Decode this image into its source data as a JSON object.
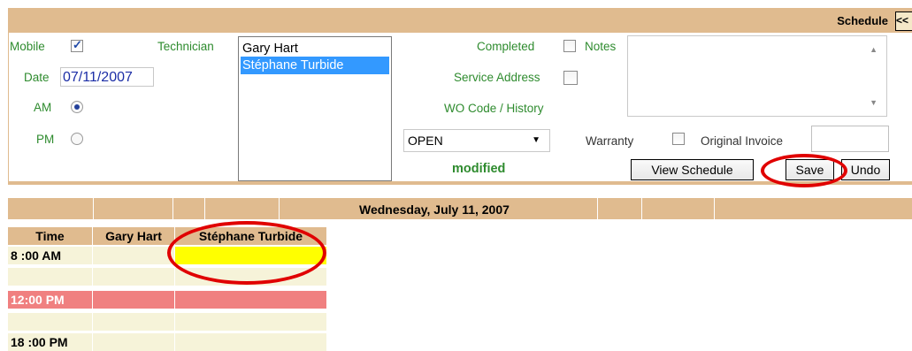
{
  "header": {
    "title": "Schedule",
    "collapse_label": "<<"
  },
  "form": {
    "mobile": {
      "label": "Mobile",
      "checked": true
    },
    "date": {
      "label": "Date",
      "value": "07/11/2007"
    },
    "am": {
      "label": "AM",
      "selected": true
    },
    "pm": {
      "label": "PM",
      "selected": false
    },
    "technician": {
      "label": "Technician",
      "options": [
        "Gary Hart",
        "Stéphane Turbide"
      ],
      "selected": "Stéphane Turbide"
    },
    "completed": {
      "label": "Completed",
      "checked": false
    },
    "service_address": {
      "label": "Service Address",
      "checked": false
    },
    "wo_code": {
      "label": "WO Code / History"
    },
    "status_select": {
      "value": "OPEN"
    },
    "status_text": "modified",
    "notes": {
      "label": "Notes",
      "value": ""
    },
    "warranty": {
      "label": "Warranty",
      "checked": false
    },
    "original_invoice": {
      "label": "Original Invoice",
      "value": ""
    },
    "buttons": {
      "view_schedule": "View Schedule",
      "save": "Save",
      "undo": "Undo"
    }
  },
  "calendar": {
    "day_title": "Wednesday, July 11, 2007",
    "columns": [
      "Time",
      "Gary Hart",
      "Stéphane Turbide"
    ],
    "rows": [
      {
        "time": "8 :00 AM",
        "style": "normal",
        "highlight": "Stéphane Turbide"
      },
      {
        "time": "",
        "style": "normal"
      },
      {
        "time": "12:00 PM",
        "style": "noon"
      },
      {
        "time": "",
        "style": "normal"
      },
      {
        "time": "18 :00 PM",
        "style": "normal"
      }
    ],
    "colors": {
      "header": "#e0bb8f",
      "row": "#f6f3d9",
      "noon": "#f08080",
      "highlight": "#ffff00",
      "annotation": "#e00000"
    }
  }
}
